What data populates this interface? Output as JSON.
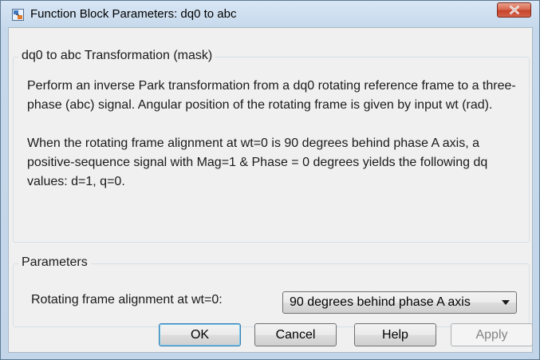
{
  "window": {
    "title": "Function Block Parameters: dq0 to abc"
  },
  "description_group": {
    "title": "dq0 to abc Transformation (mask)",
    "paragraph1": "Perform an inverse Park transformation from a dq0 rotating reference frame to a three-phase (abc) signal. Angular position of the rotating frame is given by input wt (rad).",
    "paragraph2": "When the rotating frame alignment at wt=0 is 90 degrees behind phase A axis, a positive-sequence signal with Mag=1 & Phase = 0 degrees yields the following dq values: d=1, q=0."
  },
  "parameters_group": {
    "title": "Parameters",
    "alignment_label": "Rotating frame alignment at wt=0:",
    "alignment_value": "90 degrees behind phase A axis"
  },
  "buttons": {
    "ok": "OK",
    "cancel": "Cancel",
    "help": "Help",
    "apply": "Apply"
  },
  "icons": {
    "app_icon": "simulink-block-icon",
    "close_icon": "close-icon",
    "dropdown_icon": "chevron-down-icon"
  },
  "colors": {
    "close_button": "#c6432a",
    "default_button_border": "#3c7fb1",
    "disabled_text": "#838383"
  }
}
